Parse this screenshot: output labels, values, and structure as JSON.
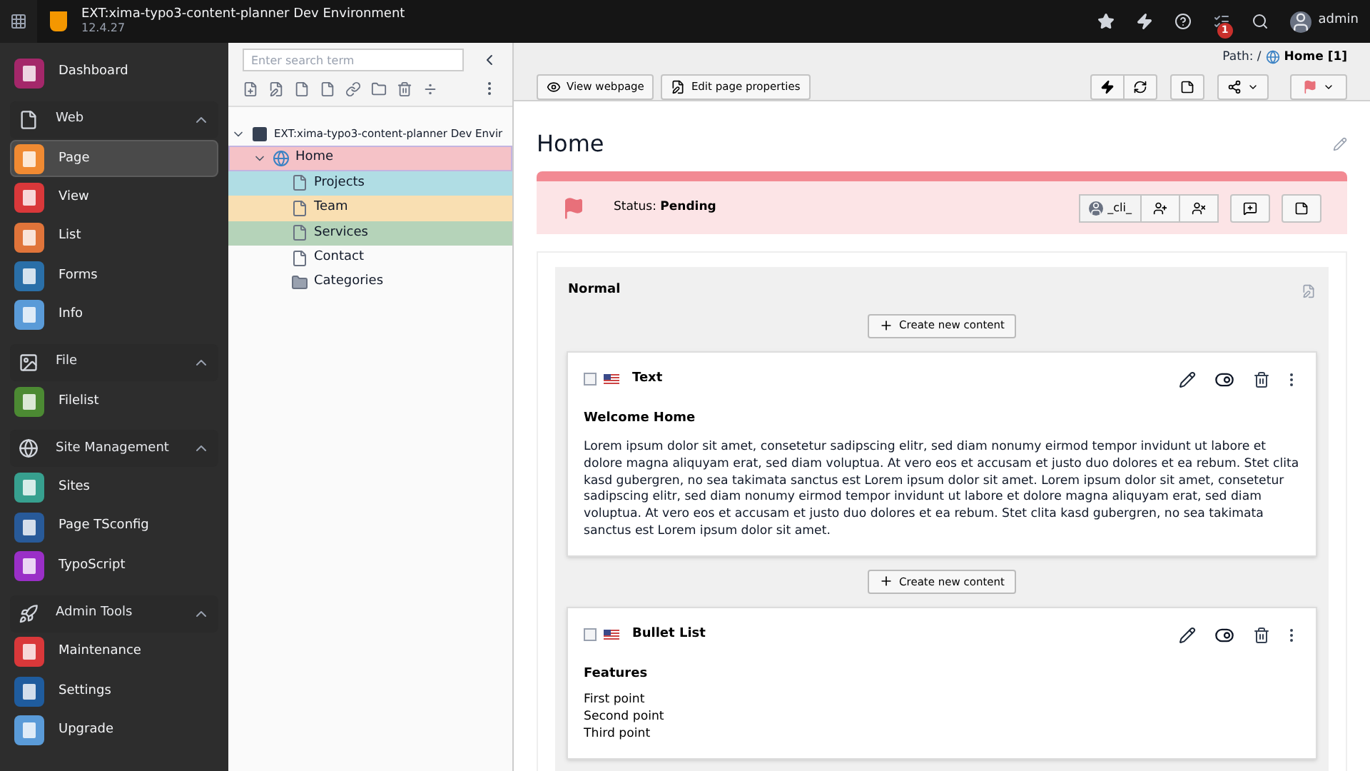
{
  "topbar": {
    "title": "EXT:xima-typo3-content-planner Dev Environment",
    "version": "12.4.27",
    "badge": "1",
    "user": "admin"
  },
  "sidebar": {
    "top_items": [
      {
        "label": "Dashboard",
        "color": "#a4276a",
        "selected": false
      }
    ],
    "groups": [
      {
        "label": "Web",
        "expanded": true,
        "kind": "page",
        "items": [
          {
            "label": "Page",
            "color": "#f08a32",
            "selected": true
          },
          {
            "label": "View",
            "color": "#d9383a",
            "selected": false
          },
          {
            "label": "List",
            "color": "#e0743a",
            "selected": false
          },
          {
            "label": "Forms",
            "color": "#2a6fa8",
            "selected": false
          },
          {
            "label": "Info",
            "color": "#5a9bd8",
            "selected": false
          }
        ]
      },
      {
        "label": "File",
        "expanded": true,
        "kind": "image",
        "items": [
          {
            "label": "Filelist",
            "color": "#4c8a33",
            "selected": false
          }
        ]
      },
      {
        "label": "Site Management",
        "expanded": true,
        "kind": "globe",
        "items": [
          {
            "label": "Sites",
            "color": "#37a08f",
            "selected": false
          },
          {
            "label": "Page TSconfig",
            "color": "#285a99",
            "selected": false
          },
          {
            "label": "TypoScript",
            "color": "#9a2fc7",
            "selected": false
          }
        ]
      },
      {
        "label": "Admin Tools",
        "expanded": true,
        "kind": "rocket",
        "items": [
          {
            "label": "Maintenance",
            "color": "#d9383a",
            "selected": false
          },
          {
            "label": "Settings",
            "color": "#1f5c9e",
            "selected": false
          },
          {
            "label": "Upgrade",
            "color": "#5a9bd8",
            "selected": false
          }
        ]
      }
    ]
  },
  "tree": {
    "placeholder": "Enter search term",
    "root": {
      "label": "EXT:xima-typo3-content-planner Dev Envir",
      "kind": "root",
      "expanded": true,
      "children": [
        {
          "label": "Home",
          "kind": "site",
          "color": "#f5c2c7",
          "expanded": true,
          "children": [
            {
              "label": "Projects",
              "kind": "page",
              "color": "#b0dde4"
            },
            {
              "label": "Team",
              "kind": "page",
              "color": "#f9dfb2"
            },
            {
              "label": "Services",
              "kind": "page",
              "color": "#b5d3b9"
            },
            {
              "label": "Contact",
              "kind": "page"
            },
            {
              "label": "Categories",
              "kind": "folder"
            }
          ]
        }
      ]
    }
  },
  "docheader": {
    "path_label": "Path: /",
    "path_page": "Home [1]",
    "buttons": [
      "View webpage",
      "Edit page properties"
    ]
  },
  "page_title": "Home",
  "status": {
    "text": "Status: **Pending**",
    "assignee": "_cli_"
  },
  "column": {
    "title": "Normal",
    "items": [
      {
        "kind": "create",
        "label": "Create new content"
      },
      {
        "kind": "element",
        "type_label": "Text",
        "header": "Welcome Home",
        "body": "Lorem ipsum dolor sit amet, consetetur sadipscing elitr, sed diam nonumy eirmod tempor invidunt ut labore et dolore magna aliquyam erat, sed diam voluptua. At vero eos et accusam et justo duo dolores et ea rebum. Stet clita kasd gubergren, no sea takimata sanctus est Lorem ipsum dolor sit amet. Lorem ipsum dolor sit amet, consetetur sadipscing elitr, sed diam nonumy eirmod tempor invidunt ut labore et dolore magna aliquyam erat, sed diam voluptua. At vero eos et accusam et justo duo dolores et ea rebum. Stet clita kasd gubergren, no sea takimata sanctus est Lorem ipsum dolor sit amet."
      },
      {
        "kind": "create",
        "label": "Create new content"
      },
      {
        "kind": "element",
        "type_label": "Bullet List",
        "header": "Features",
        "bullets": [
          "First point",
          "Second point",
          "Third point"
        ]
      }
    ]
  }
}
